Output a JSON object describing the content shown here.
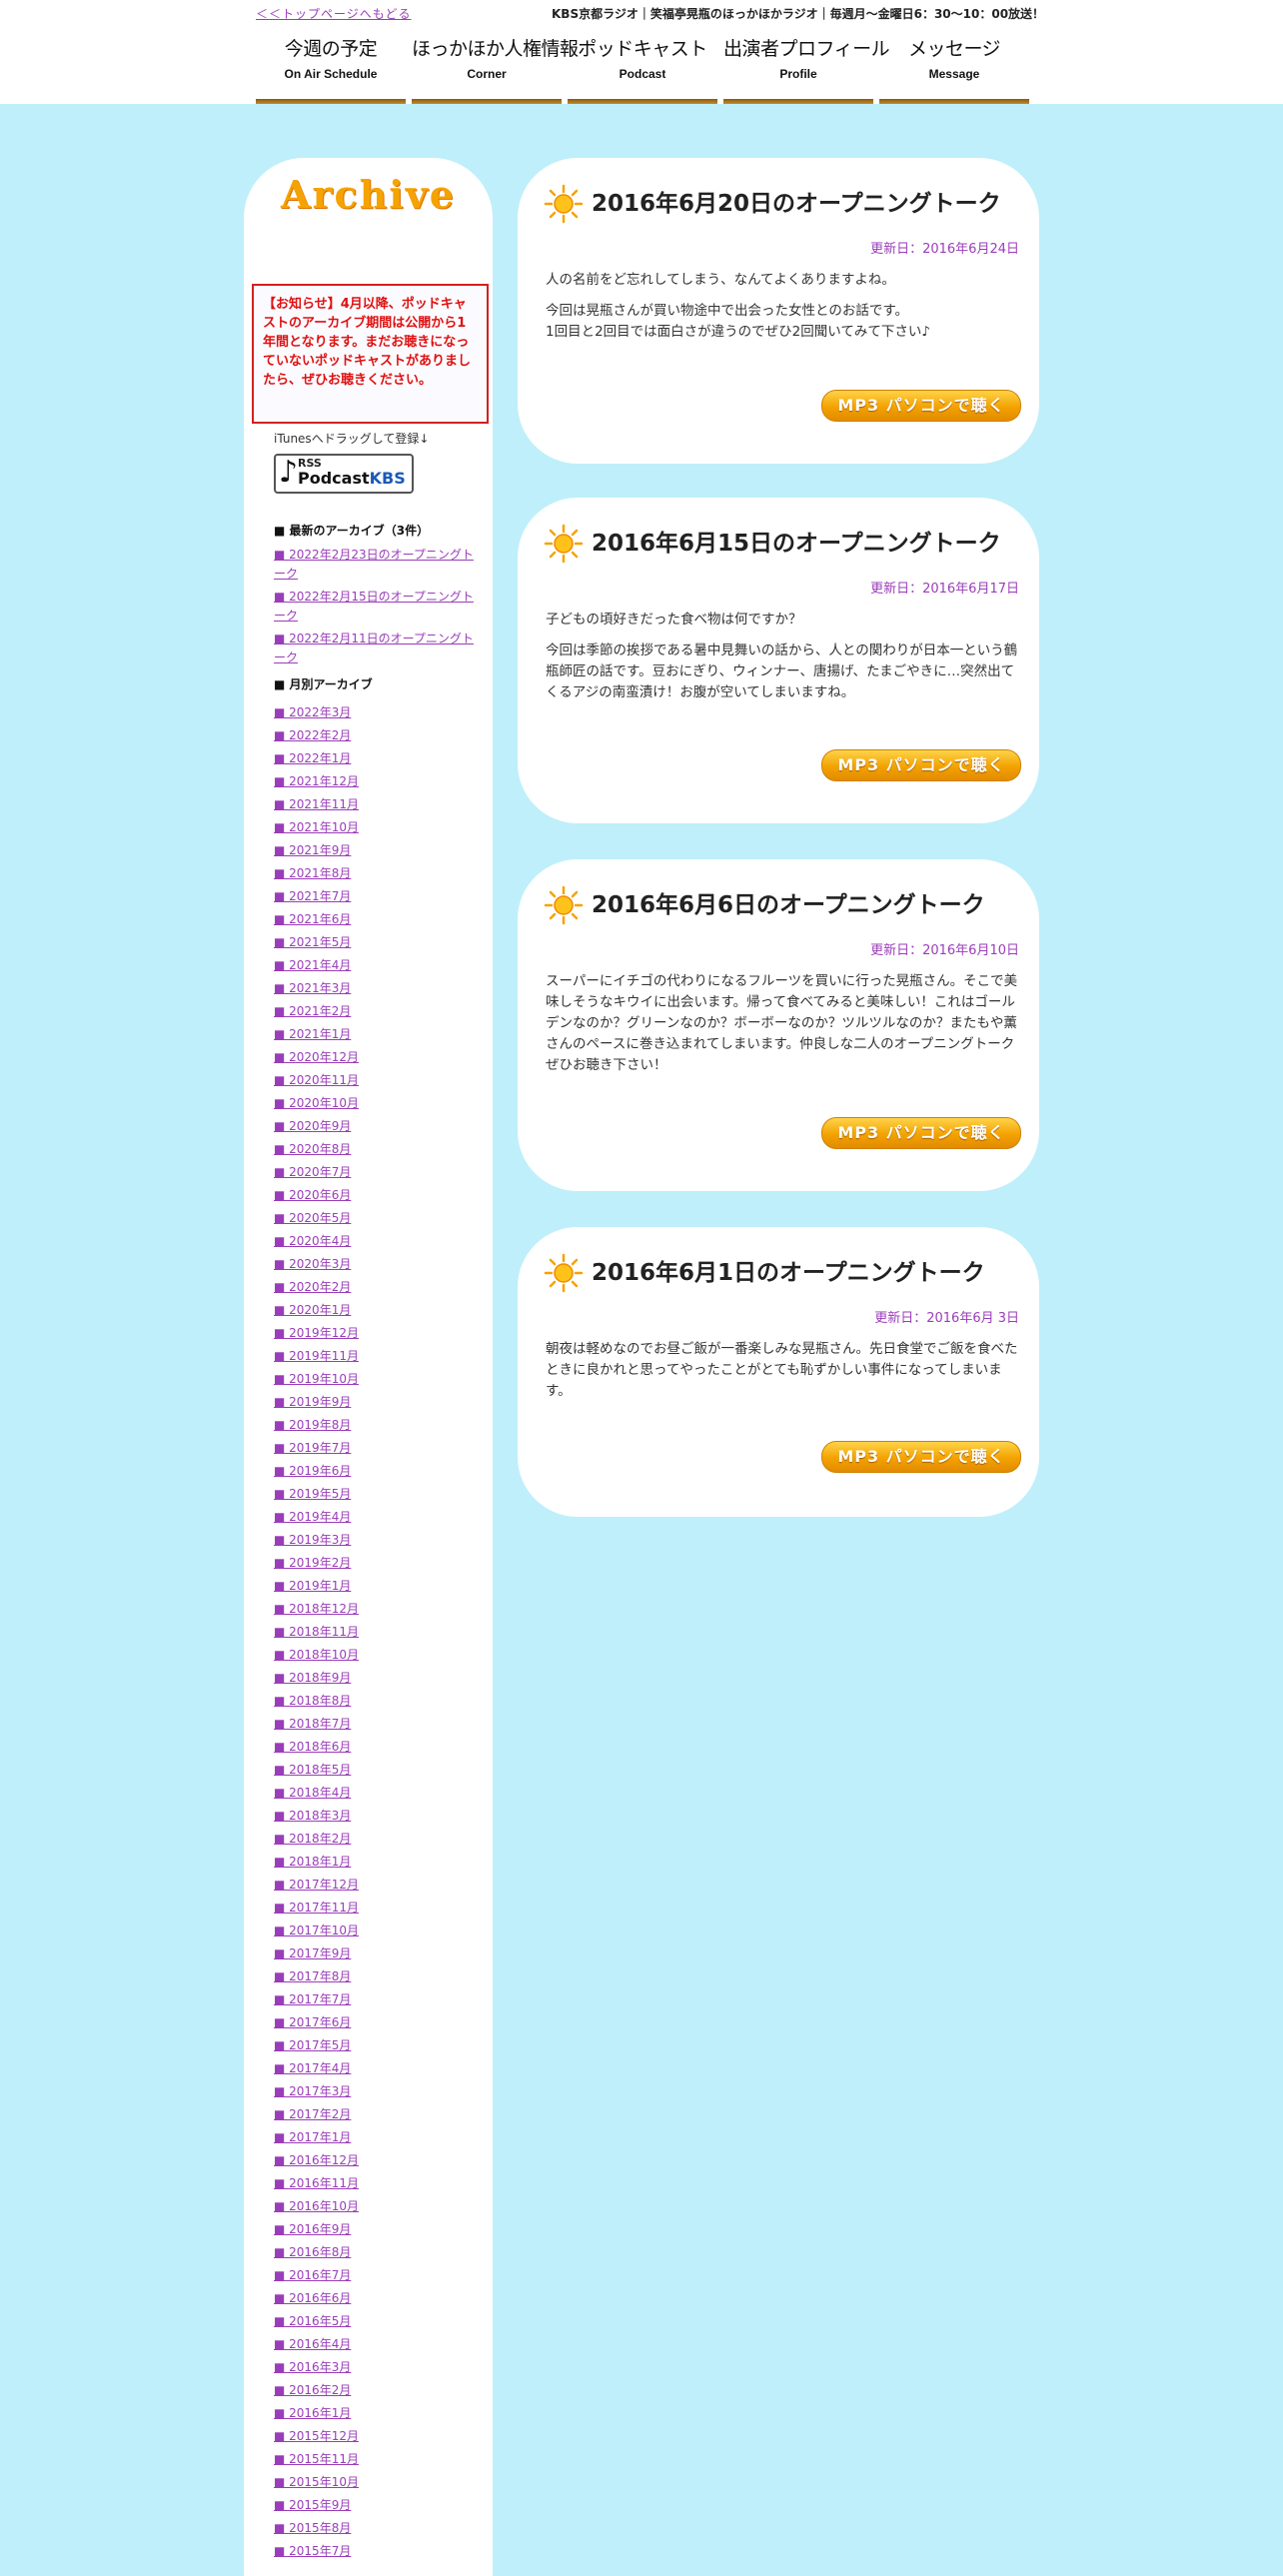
{
  "header": {
    "back_link": "＜＜トップページへもどる",
    "tagline": "KBS京都ラジオ｜笑福亭晃瓶のほっかほかラジオ｜毎週月～金曜日6：30～10：00放送！",
    "nav": [
      {
        "jp": "今週の予定",
        "en": "On Air Schedule"
      },
      {
        "jp": "ほっかほか人権情報",
        "en": "Corner"
      },
      {
        "jp": "ポッドキャスト",
        "en": "Podcast"
      },
      {
        "jp": "出演者プロフィール",
        "en": "Profile"
      },
      {
        "jp": "メッセージ",
        "en": "Message"
      }
    ],
    "nav_bar_color": "#a87020"
  },
  "sidebar": {
    "title": "Archive",
    "notice": "【お知らせ】4月以降、ポッドキャストのアーカイブ期間は公開から1年間となります。まだお聴きになっていないポッドキャストがありましたら、ぜひお聴きください。",
    "itunes_text": "iTunesへドラッグして登録↓",
    "badge": {
      "rss": "RSS",
      "podcast": "Podcast",
      "kbs": "KBS"
    },
    "recent_heading": "■ 最新のアーカイブ（3件）",
    "recent": [
      "■ 2022年2月23日のオープニングトーク",
      "■ 2022年2月15日のオープニングトーク",
      "■ 2022年2月11日のオープニングトーク"
    ],
    "monthly_heading": "■ 月別アーカイブ",
    "months": [
      "■ 2022年3月",
      "■ 2022年2月",
      "■ 2022年1月",
      "■ 2021年12月",
      "■ 2021年11月",
      "■ 2021年10月",
      "■ 2021年9月",
      "■ 2021年8月",
      "■ 2021年7月",
      "■ 2021年6月",
      "■ 2021年5月",
      "■ 2021年4月",
      "■ 2021年3月",
      "■ 2021年2月",
      "■ 2021年1月",
      "■ 2020年12月",
      "■ 2020年11月",
      "■ 2020年10月",
      "■ 2020年9月",
      "■ 2020年8月",
      "■ 2020年7月",
      "■ 2020年6月",
      "■ 2020年5月",
      "■ 2020年4月",
      "■ 2020年3月",
      "■ 2020年2月",
      "■ 2020年1月",
      "■ 2019年12月",
      "■ 2019年11月",
      "■ 2019年10月",
      "■ 2019年9月",
      "■ 2019年8月",
      "■ 2019年7月",
      "■ 2019年6月",
      "■ 2019年5月",
      "■ 2019年4月",
      "■ 2019年3月",
      "■ 2019年2月",
      "■ 2019年1月",
      "■ 2018年12月",
      "■ 2018年11月",
      "■ 2018年10月",
      "■ 2018年9月",
      "■ 2018年8月",
      "■ 2018年7月",
      "■ 2018年6月",
      "■ 2018年5月",
      "■ 2018年4月",
      "■ 2018年3月",
      "■ 2018年2月",
      "■ 2018年1月",
      "■ 2017年12月",
      "■ 2017年11月",
      "■ 2017年10月",
      "■ 2017年9月",
      "■ 2017年8月",
      "■ 2017年7月",
      "■ 2017年6月",
      "■ 2017年5月",
      "■ 2017年4月",
      "■ 2017年3月",
      "■ 2017年2月",
      "■ 2017年1月",
      "■ 2016年12月",
      "■ 2016年11月",
      "■ 2016年10月",
      "■ 2016年9月",
      "■ 2016年8月",
      "■ 2016年7月",
      "■ 2016年6月",
      "■ 2016年5月",
      "■ 2016年4月",
      "■ 2016年3月",
      "■ 2016年2月",
      "■ 2016年1月",
      "■ 2015年12月",
      "■ 2015年11月",
      "■ 2015年10月",
      "■ 2015年9月",
      "■ 2015年8月",
      "■ 2015年7月"
    ]
  },
  "episodes": [
    {
      "title": "2016年6月20日のオープニングトーク",
      "updated": "更新日：2016年6月24日",
      "paragraphs": [
        "人の名前をど忘れしてしまう、なんてよくありますよね。",
        "今回は晃瓶さんが買い物途中で出会った女性とのお話です。\n1回目と2回目では面白さが違うのでぜひ2回聞いてみて下さい♪"
      ],
      "button": "MP3 パソコンで聴く"
    },
    {
      "title": "2016年6月15日のオープニングトーク",
      "updated": "更新日：2016年6月17日",
      "paragraphs": [
        "子どもの頃好きだった食べ物は何ですか？",
        "今回は季節の挨拶である暑中見舞いの話から、人との関わりが日本一という鶴瓶師匠の話です。豆おにぎり、ウィンナー、唐揚げ、たまごやきに…突然出てくるアジの南蛮漬け！お腹が空いてしまいますね。"
      ],
      "button": "MP3 パソコンで聴く"
    },
    {
      "title": "2016年6月6日のオープニングトーク",
      "updated": "更新日：2016年6月10日",
      "paragraphs": [
        "スーパーにイチゴの代わりになるフルーツを買いに行った晃瓶さん。そこで美味しそうなキウイに出会います。帰って食べてみると美味しい！これはゴールデンなのか？グリーンなのか？ボーボーなのか？ツルツルなのか？またもや薫さんのペースに巻き込まれてしまいます。仲良しな二人のオープニングトークぜひお聴き下さい！"
      ],
      "button": "MP3 パソコンで聴く"
    },
    {
      "title": "2016年6月1日のオープニングトーク",
      "updated": "更新日：2016年6月 3日",
      "paragraphs": [
        "朝夜は軽めなのでお昼ご飯が一番楽しみな晃瓶さん。先日食堂でご飯を食べたときに良かれと思ってやったことがとても恥ずかしい事件になってしまいます。"
      ],
      "button": "MP3 パソコンで聴く"
    }
  ],
  "colors": {
    "background": "#bfeffa",
    "link": "#9a3db8",
    "notice": "#e01010",
    "button": "#f3a200"
  }
}
